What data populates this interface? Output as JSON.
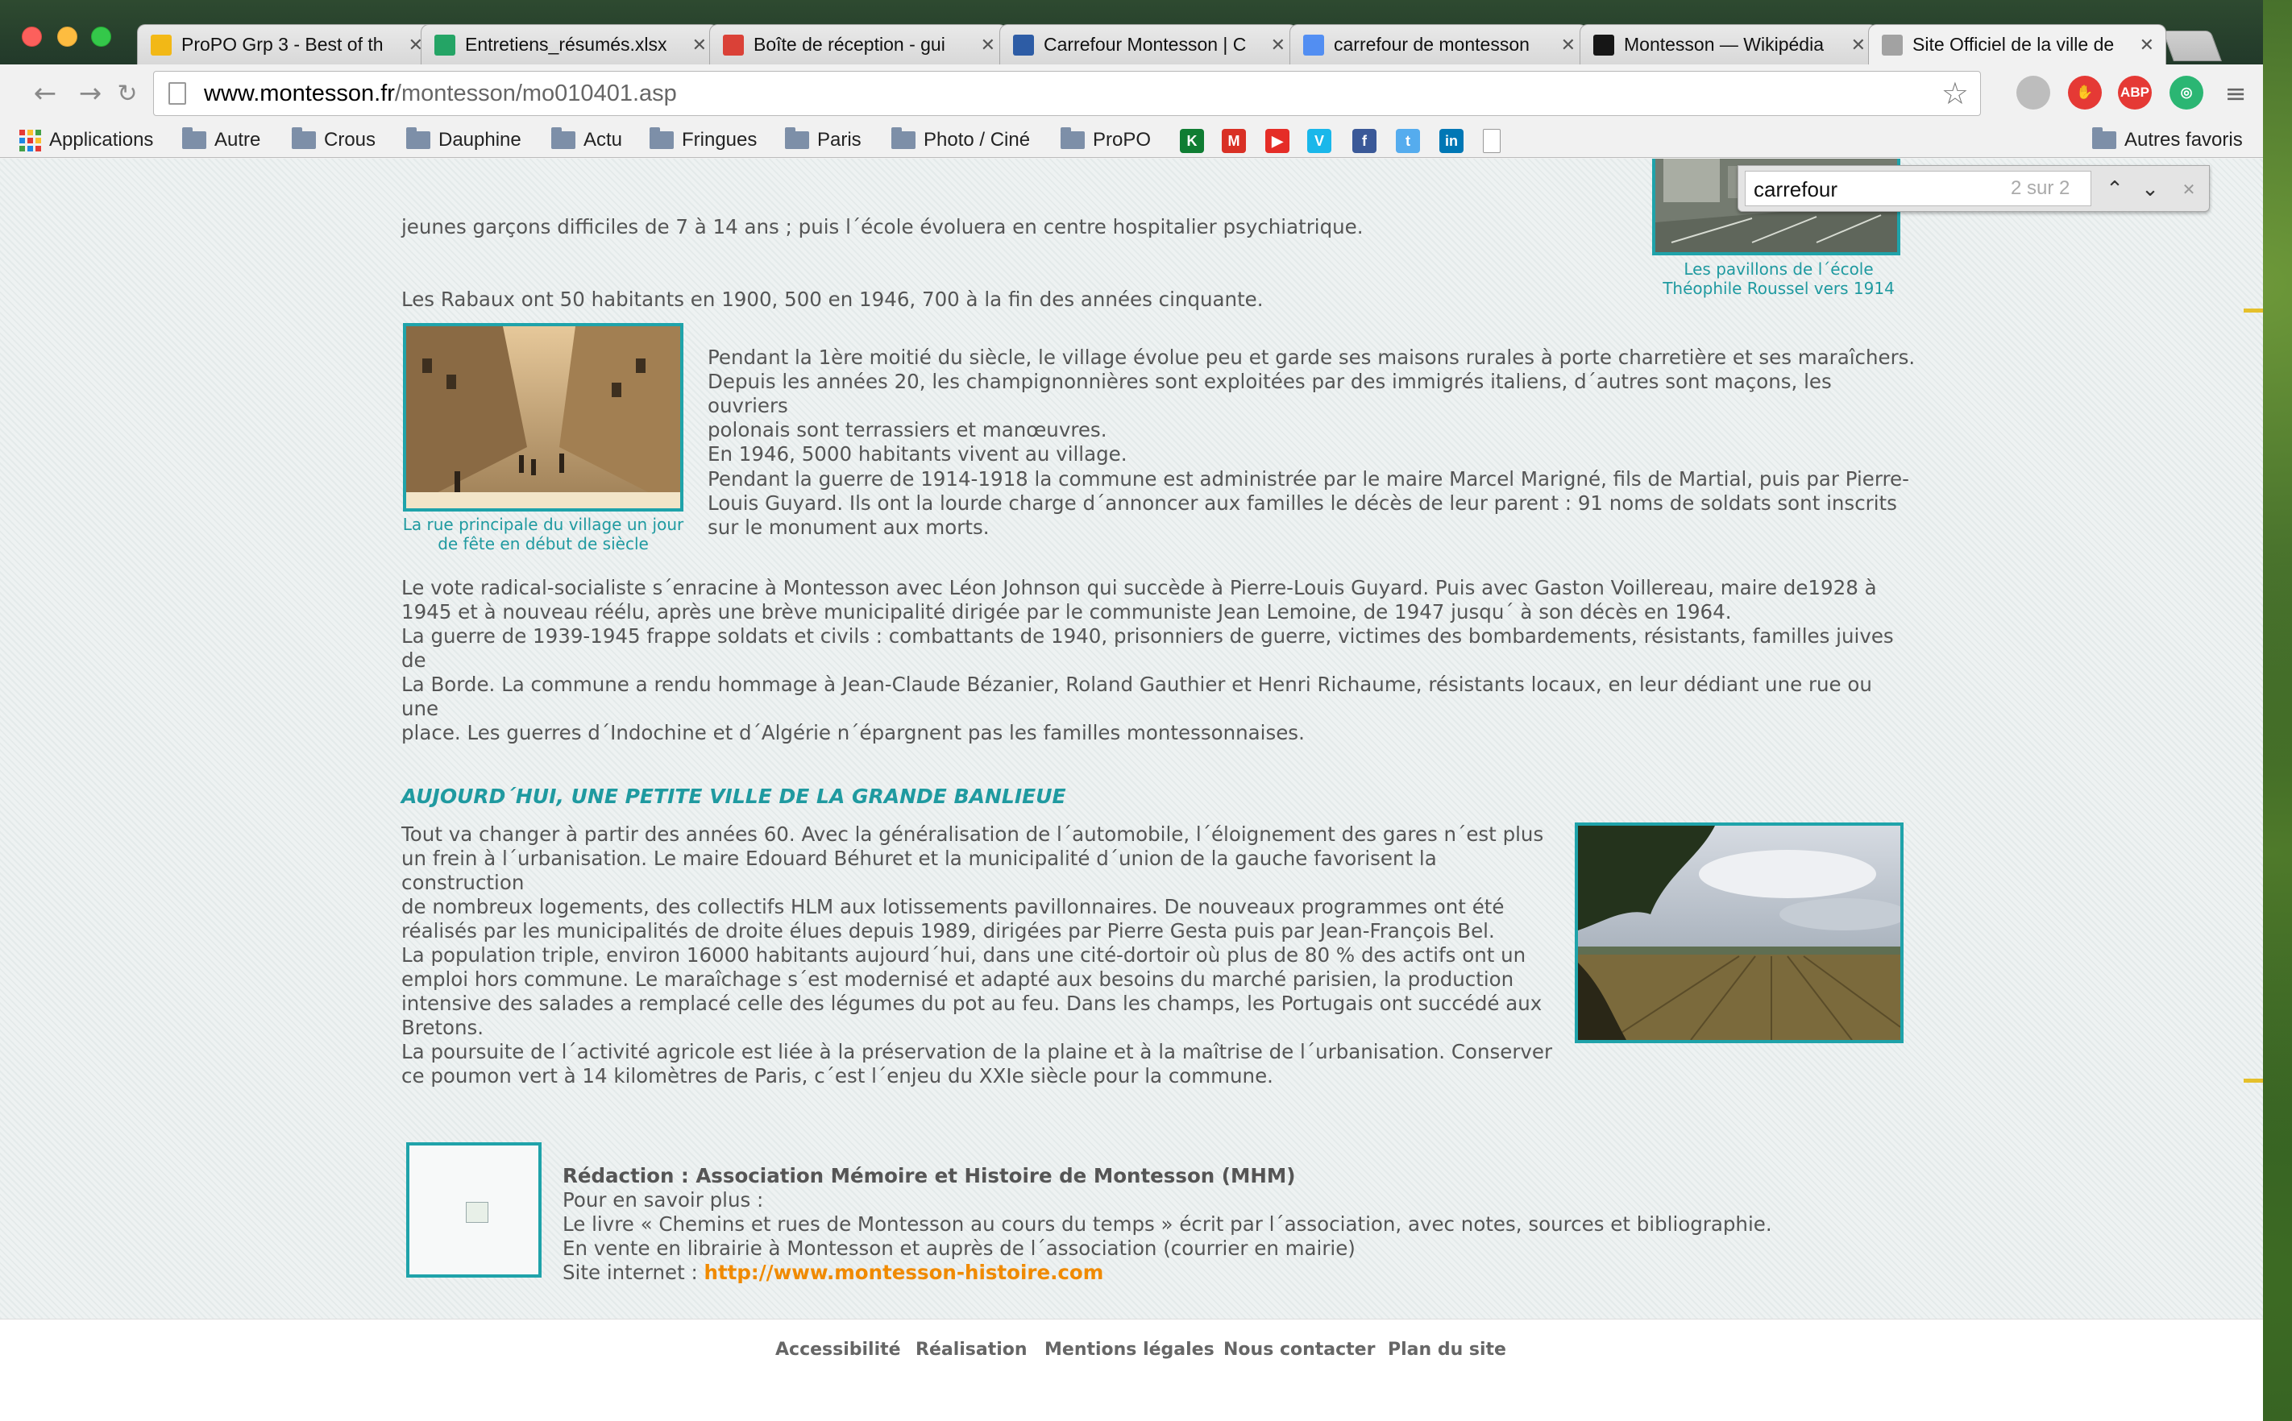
{
  "browser": {
    "tabs": [
      {
        "title": "ProPO Grp 3 - Best of th",
        "favicon": "drive-icon",
        "color": "#f4b400"
      },
      {
        "title": "Entretiens_résumés.xlsx",
        "favicon": "sheets-icon",
        "color": "#0f9d58"
      },
      {
        "title": "Boîte de réception - gui",
        "favicon": "gmail-icon",
        "color": "#d93025"
      },
      {
        "title": "Carrefour Montesson | C",
        "favicon": "carrefour-icon",
        "color": "#1a4e9e"
      },
      {
        "title": "carrefour de montesson",
        "favicon": "google-icon",
        "color": "#4285f4"
      },
      {
        "title": "Montesson — Wikipédia",
        "favicon": "wikipedia-icon",
        "color": "#000000"
      },
      {
        "title": "Site Officiel de la ville de",
        "favicon": "page-icon",
        "color": "#999999"
      }
    ],
    "active_tab": 6,
    "close_glyph": "✕",
    "url_host": "www.montesson.fr",
    "url_path": "/montesson/mo010401.asp",
    "extensions": [
      {
        "name": "puzzle-icon",
        "label": "",
        "color": "#bdbdbd"
      },
      {
        "name": "hand-block-icon",
        "label": "✋",
        "color": "#e53935"
      },
      {
        "name": "adblock-plus-icon",
        "label": "ABP",
        "color": "#e53935"
      },
      {
        "name": "grammarly-icon",
        "label": "◎",
        "color": "#2bb673"
      }
    ],
    "bookmarks": [
      {
        "label": "Applications",
        "type": "apps"
      },
      {
        "label": "Autre",
        "type": "folder"
      },
      {
        "label": "Crous",
        "type": "folder"
      },
      {
        "label": "Dauphine",
        "type": "folder"
      },
      {
        "label": "Actu",
        "type": "folder"
      },
      {
        "label": "Fringues",
        "type": "folder"
      },
      {
        "label": "Paris",
        "type": "folder"
      },
      {
        "label": "Photo / Ciné",
        "type": "folder"
      },
      {
        "label": "ProPO",
        "type": "folder"
      }
    ],
    "bookmark_icons": [
      {
        "name": "kickstarter-icon",
        "glyph": "K",
        "color": "#0f7d33"
      },
      {
        "name": "gmail-bookmark-icon",
        "glyph": "M",
        "color": "#d93025"
      },
      {
        "name": "youtube-icon",
        "glyph": "▶",
        "color": "#e52d27"
      },
      {
        "name": "vimeo-icon",
        "glyph": "V",
        "color": "#1ab7ea"
      },
      {
        "name": "facebook-icon",
        "glyph": "f",
        "color": "#3b5998"
      },
      {
        "name": "twitter-icon",
        "glyph": "t",
        "color": "#55acee"
      },
      {
        "name": "linkedin-icon",
        "glyph": "in",
        "color": "#0077b5"
      },
      {
        "name": "document-icon",
        "glyph": "",
        "color": "#ffffff"
      }
    ],
    "other_bookmarks": "Autres favoris",
    "find": {
      "query": "carrefour",
      "count": "2 sur 2",
      "prev": "⌃",
      "next": "⌄",
      "close": "✕"
    }
  },
  "page": {
    "intro_lines": [
      "jeunes garçons difficiles de 7 à 14 ans ; puis l´école évoluera en centre hospitalier psychiatrique.",
      "Les Rabaux ont 50 habitants en 1900, 500 en 1946, 700 à la fin des années cinquante."
    ],
    "caption_top": "Les pavillons de l´école\nThéophile Roussel vers 1914",
    "caption_street": "La rue principale du village un jour\nde fête en début de siècle",
    "para_village": "Pendant la 1ère moitié du siècle, le village évolue peu et garde ses maisons rurales à porte charretière et ses maraîchers.\nDepuis les années 20, les champignonnières sont exploitées par des immigrés italiens, d´autres sont maçons, les ouvriers\npolonais sont terrassiers et manœuvres.\nEn 1946, 5000 habitants vivent au village.",
    "para_war1": "Pendant la guerre de 1914-1918 la commune est administrée par le maire Marcel Marigné, fils de Martial, puis par Pierre-\nLouis Guyard. Ils ont la lourde charge d´annoncer aux familles le décès de leur parent : 91 noms de soldats sont inscrits\nsur le monument aux morts.",
    "para_radical": "Le vote radical-socialiste s´enracine à Montesson avec Léon Johnson qui succède à Pierre-Louis Guyard. Puis avec Gaston Voillereau, maire de1928 à\n1945 et à nouveau réélu, après une brève municipalité dirigée par le communiste Jean Lemoine, de 1947 jusqu´ à son décès en 1964.\nLa guerre de 1939-1945 frappe soldats et civils : combattants de 1940, prisonniers de guerre, victimes des bombardements, résistants, familles juives de\nLa Borde. La commune a rendu hommage à Jean-Claude Bézanier, Roland Gauthier et Henri Richaume, résistants locaux, en leur dédiant une rue ou une\nplace. Les guerres d´Indochine et d´Algérie n´épargnent pas les familles montessonnaises.",
    "section_title": "AUJOURD´HUI, UNE PETITE VILLE DE LA GRANDE BANLIEUE",
    "para_today": "Tout va changer à partir des années 60. Avec la généralisation de l´automobile, l´éloignement des gares n´est plus\nun frein à l´urbanisation. Le maire Edouard Béhuret et la municipalité d´union de la gauche favorisent la construction\nde nombreux logements, des collectifs HLM aux lotissements pavillonnaires. De nouveaux programmes ont été\nréalisés par les municipalités de droite élues depuis 1989, dirigées par Pierre Gesta puis par Jean-François Bel.\nLa population triple, environ 16000 habitants aujourd´hui, dans une cité-dortoir où plus de 80 % des actifs ont un\nemploi hors commune. Le maraîchage s´est modernisé et adapté aux besoins du marché parisien, la production\nintensive des salades a remplacé celle des légumes du pot au feu. Dans les champs, les Portugais ont succédé aux\nBretons.\nLa poursuite de l´activité agricole est liée à la préservation de la plaine et à la maîtrise de l´urbanisation. Conserver\nce poumon vert à 14 kilomètres de Paris, c´est l´enjeu du XXIe siècle pour la commune.",
    "credit_title": "Rédaction : Association Mémoire et Histoire de Montesson (MHM)",
    "credit_more": "Pour en savoir plus :",
    "credit_book": "Le livre « Chemins et rues de Montesson au cours du temps » écrit par l´association, avec notes, sources et bibliographie.",
    "credit_sale": "En vente en librairie à Montesson et auprès de l´association (courrier en mairie)",
    "credit_site_label": "Site internet : ",
    "credit_site_url": "http://www.montesson-histoire.com",
    "footer_links": [
      "Accessibilité",
      "Réalisation",
      "Mentions légales",
      "Nous contacter",
      "Plan du site"
    ],
    "accent_color": "#1f9aa0",
    "link_color": "#f08a00"
  }
}
